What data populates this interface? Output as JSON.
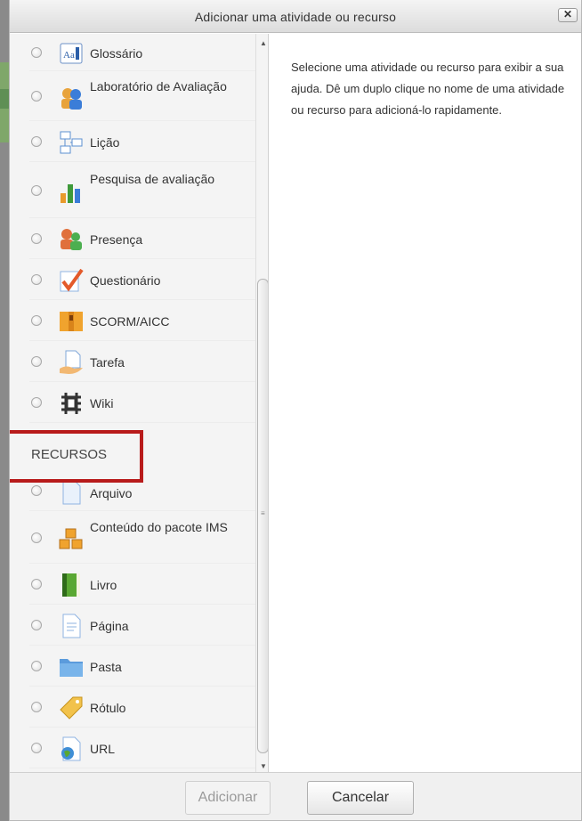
{
  "dialog": {
    "title": "Adicionar uma atividade ou recurso",
    "close_label": "✕"
  },
  "activities": [
    {
      "label": "Glossário",
      "icon": "glossary-icon"
    },
    {
      "label": "Laboratório de Avaliação",
      "icon": "workshop-icon"
    },
    {
      "label": "Lição",
      "icon": "lesson-icon"
    },
    {
      "label": "Pesquisa de avaliação",
      "icon": "survey-icon"
    },
    {
      "label": "Presença",
      "icon": "attendance-icon"
    },
    {
      "label": "Questionário",
      "icon": "quiz-icon"
    },
    {
      "label": "SCORM/AICC",
      "icon": "scorm-icon"
    },
    {
      "label": "Tarefa",
      "icon": "assignment-icon"
    },
    {
      "label": "Wiki",
      "icon": "wiki-icon"
    }
  ],
  "resources_section": {
    "title": "RECURSOS",
    "highlight_color": "#b81b1b"
  },
  "resources": [
    {
      "label": "Arquivo",
      "icon": "file-icon"
    },
    {
      "label": "Conteúdo do pacote IMS",
      "icon": "ims-package-icon"
    },
    {
      "label": "Livro",
      "icon": "book-icon"
    },
    {
      "label": "Página",
      "icon": "page-icon"
    },
    {
      "label": "Pasta",
      "icon": "folder-icon"
    },
    {
      "label": "Rótulo",
      "icon": "label-icon"
    },
    {
      "label": "URL",
      "icon": "url-icon"
    }
  ],
  "help": {
    "text": "Selecione uma atividade ou recurso para exibir a sua ajuda. Dê um duplo clique no nome de uma atividade ou recurso para adicioná-lo rapidamente."
  },
  "footer": {
    "add_label": "Adicionar",
    "cancel_label": "Cancelar"
  }
}
